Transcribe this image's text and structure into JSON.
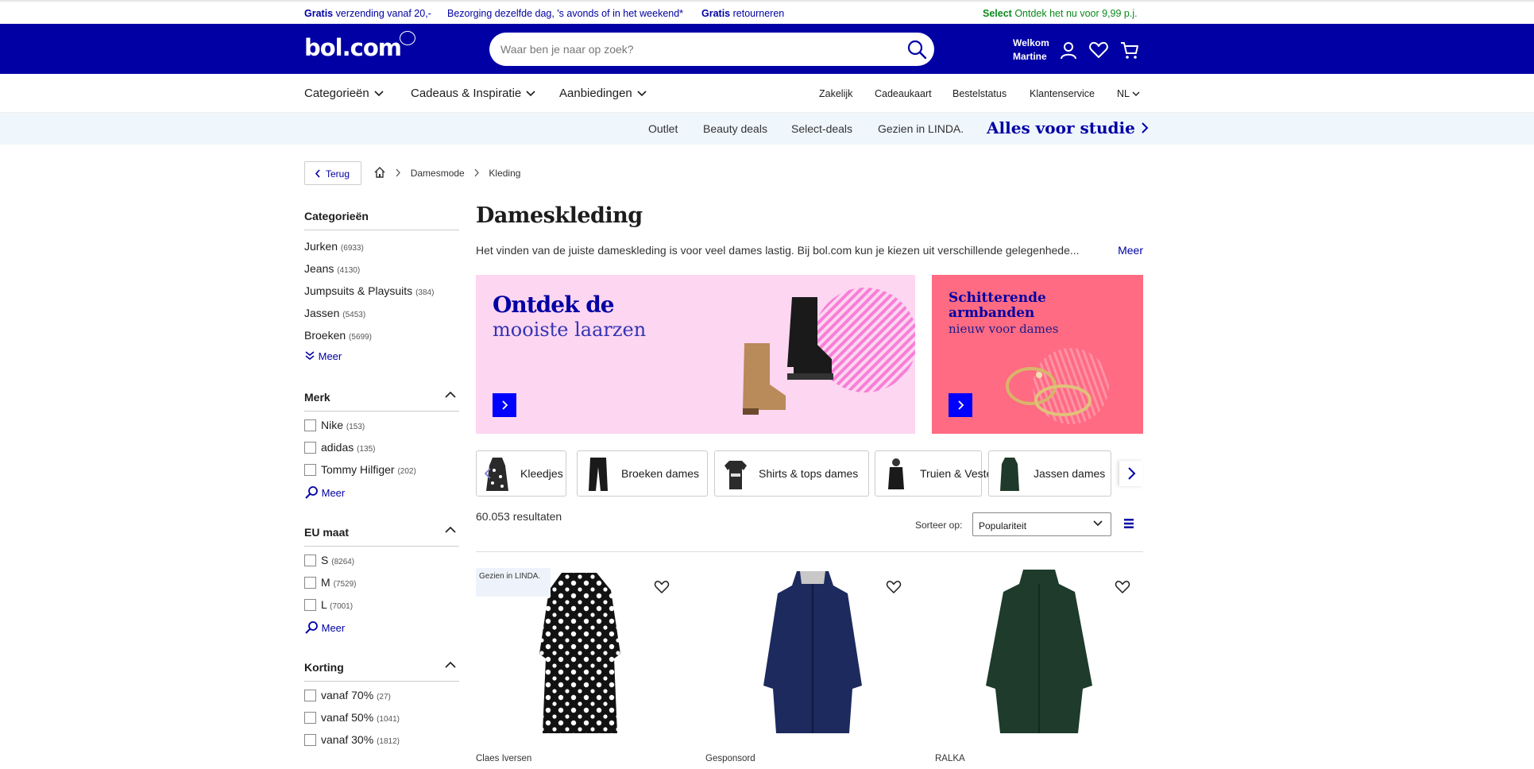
{
  "usp": {
    "item1_bold": "Gratis",
    "item1_rest": "verzending vanaf 20,-",
    "item2": "Bezorging dezelfde dag, 's avonds of in het weekend*",
    "item3_bold": "Gratis",
    "item3_rest": "retourneren",
    "select_bold": "Select",
    "select_rest": "Ontdek het nu voor 9,99 p.j."
  },
  "header": {
    "logo": "bol.com",
    "search_placeholder": "Waar ben je naar op zoek?",
    "welcome_line1": "Welkom",
    "welcome_line2": "Martine"
  },
  "nav": {
    "main": [
      "Categorieën",
      "Cadeaus & Inspiratie",
      "Aanbiedingen"
    ],
    "utility": [
      "Zakelijk",
      "Cadeaukaart",
      "Bestelstatus",
      "Klantenservice",
      "NL"
    ]
  },
  "promo_bar": {
    "links": [
      "Outlet",
      "Beauty deals",
      "Select-deals",
      "Gezien in LINDA."
    ],
    "highlight": "Alles voor studie"
  },
  "breadcrumb": {
    "back": "Terug",
    "items": [
      "Damesmode",
      "Kleding"
    ]
  },
  "sidebar": {
    "categories": {
      "title": "Categorieën",
      "items": [
        {
          "label": "Jurken",
          "count": "(6933)"
        },
        {
          "label": "Jeans",
          "count": "(4130)"
        },
        {
          "label": "Jumpsuits & Playsuits",
          "count": "(384)"
        },
        {
          "label": "Jassen",
          "count": "(5453)"
        },
        {
          "label": "Broeken",
          "count": "(5699)"
        }
      ],
      "more": "Meer"
    },
    "brand": {
      "title": "Merk",
      "items": [
        {
          "label": "Nike",
          "count": "(153)"
        },
        {
          "label": "adidas",
          "count": "(135)"
        },
        {
          "label": "Tommy Hilfiger",
          "count": "(202)"
        }
      ],
      "more": "Meer"
    },
    "size": {
      "title": "EU maat",
      "items": [
        {
          "label": "S",
          "count": "(8264)"
        },
        {
          "label": "M",
          "count": "(7529)"
        },
        {
          "label": "L",
          "count": "(7001)"
        }
      ],
      "more": "Meer"
    },
    "discount": {
      "title": "Korting",
      "items": [
        {
          "label": "vanaf 70%",
          "count": "(27)"
        },
        {
          "label": "vanaf 50%",
          "count": "(1041)"
        },
        {
          "label": "vanaf 30%",
          "count": "(1812)"
        }
      ]
    }
  },
  "main": {
    "title": "Dameskleding",
    "intro": "Het vinden van de juiste dameskleding is voor veel dames lastig. Bij bol.com kun je kiezen uit verschillende gelegenhede...",
    "intro_more": "Meer",
    "banner1": {
      "line1": "Ontdek de",
      "line2": "mooiste laarzen"
    },
    "banner2": {
      "line1": "Schitterende armbanden",
      "line2": "nieuw voor dames"
    },
    "chips": [
      "Kleedjes",
      "Broeken dames",
      "Shirts & tops dames",
      "Truien & Vesten",
      "Jassen dames"
    ],
    "results": "60.053 resultaten",
    "sort_label": "Sorteer op:",
    "sort_value": "Populariteit",
    "products": [
      {
        "brand": "Claes Iversen",
        "badge": "Gezien in LINDA."
      },
      {
        "brand": "Gesponsord"
      },
      {
        "brand": "RALKA"
      }
    ]
  },
  "colors": {
    "brand_blue": "#0000a4",
    "link_blue": "#0000ff",
    "select_green": "#0a8a1b",
    "promo_bg": "#eff6fc",
    "banner1_bg": "#fdd6f1",
    "banner2_bg": "#ff6b82"
  }
}
